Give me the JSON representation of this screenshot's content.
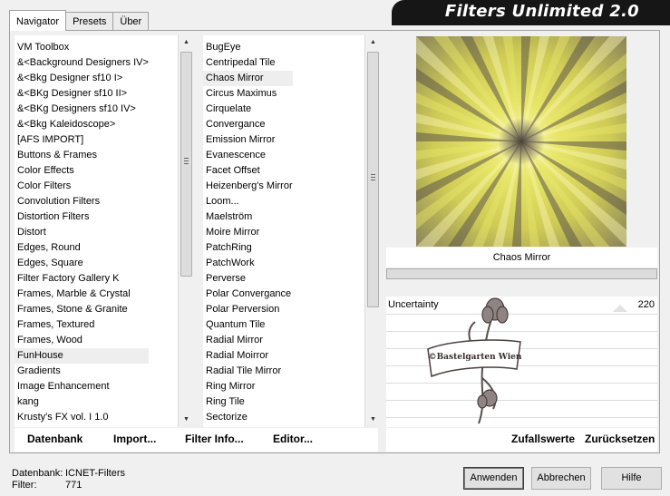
{
  "app": {
    "title": "Filters Unlimited 2.0"
  },
  "tabs": [
    {
      "label": "Navigator"
    },
    {
      "label": "Presets"
    },
    {
      "label": "Über"
    }
  ],
  "categories": {
    "items": [
      "VM Toolbox",
      "&<Background Designers IV>",
      "&<Bkg Designer sf10 I>",
      "&<BKg Designer sf10 II>",
      "&<BKg Designers sf10 IV>",
      "&<Bkg Kaleidoscope>",
      "[AFS IMPORT]",
      "Buttons & Frames",
      "Color Effects",
      "Color Filters",
      "Convolution Filters",
      "Distortion Filters",
      "Distort",
      "Edges, Round",
      "Edges, Square",
      "Filter Factory Gallery K",
      "Frames, Marble & Crystal",
      "Frames, Stone & Granite",
      "Frames, Textured",
      "Frames, Wood",
      "FunHouse",
      "Gradients",
      "Image Enhancement",
      "kang",
      "Krusty's FX vol. I 1.0"
    ],
    "selected": "FunHouse"
  },
  "filters": {
    "items": [
      "BugEye",
      "Centripedal Tile",
      "Chaos Mirror",
      "Circus Maximus",
      "Cirquelate",
      "Convergance",
      "Emission Mirror",
      "Evanescence",
      "Facet Offset",
      "Heizenberg's Mirror",
      "Loom...",
      "Maelström",
      "Moire Mirror",
      "PatchRing",
      "PatchWork",
      "Perverse",
      "Polar Convergance",
      "Polar Perversion",
      "Quantum Tile",
      "Radial Mirror",
      "Radial Moirror",
      "Radial Tile Mirror",
      "Ring Mirror",
      "Ring Tile",
      "Sectorize"
    ],
    "selected": "Chaos Mirror"
  },
  "preview": {
    "label": "Chaos Mirror",
    "colors": {
      "yellow": "#e8e66a",
      "dark": "#5c5548",
      "light": "#fbf6b2"
    }
  },
  "controls": [
    {
      "label": "Uncertainty",
      "value": "220"
    }
  ],
  "watermark": {
    "text": "©Bastelgarten Wien"
  },
  "links": {
    "datenbank": "Datenbank",
    "import": "Import...",
    "filter_info": "Filter Info...",
    "editor": "Editor...",
    "zufallswerte": "Zufallswerte",
    "zuruecksetzen": "Zurücksetzen"
  },
  "status": {
    "db_label": "Datenbank:",
    "db_value": "ICNET-Filters",
    "filter_label": "Filter:",
    "filter_value": "771"
  },
  "buttons": {
    "anwenden": "Anwenden",
    "abbrechen": "Abbrechen",
    "hilfe": "Hilfe"
  }
}
